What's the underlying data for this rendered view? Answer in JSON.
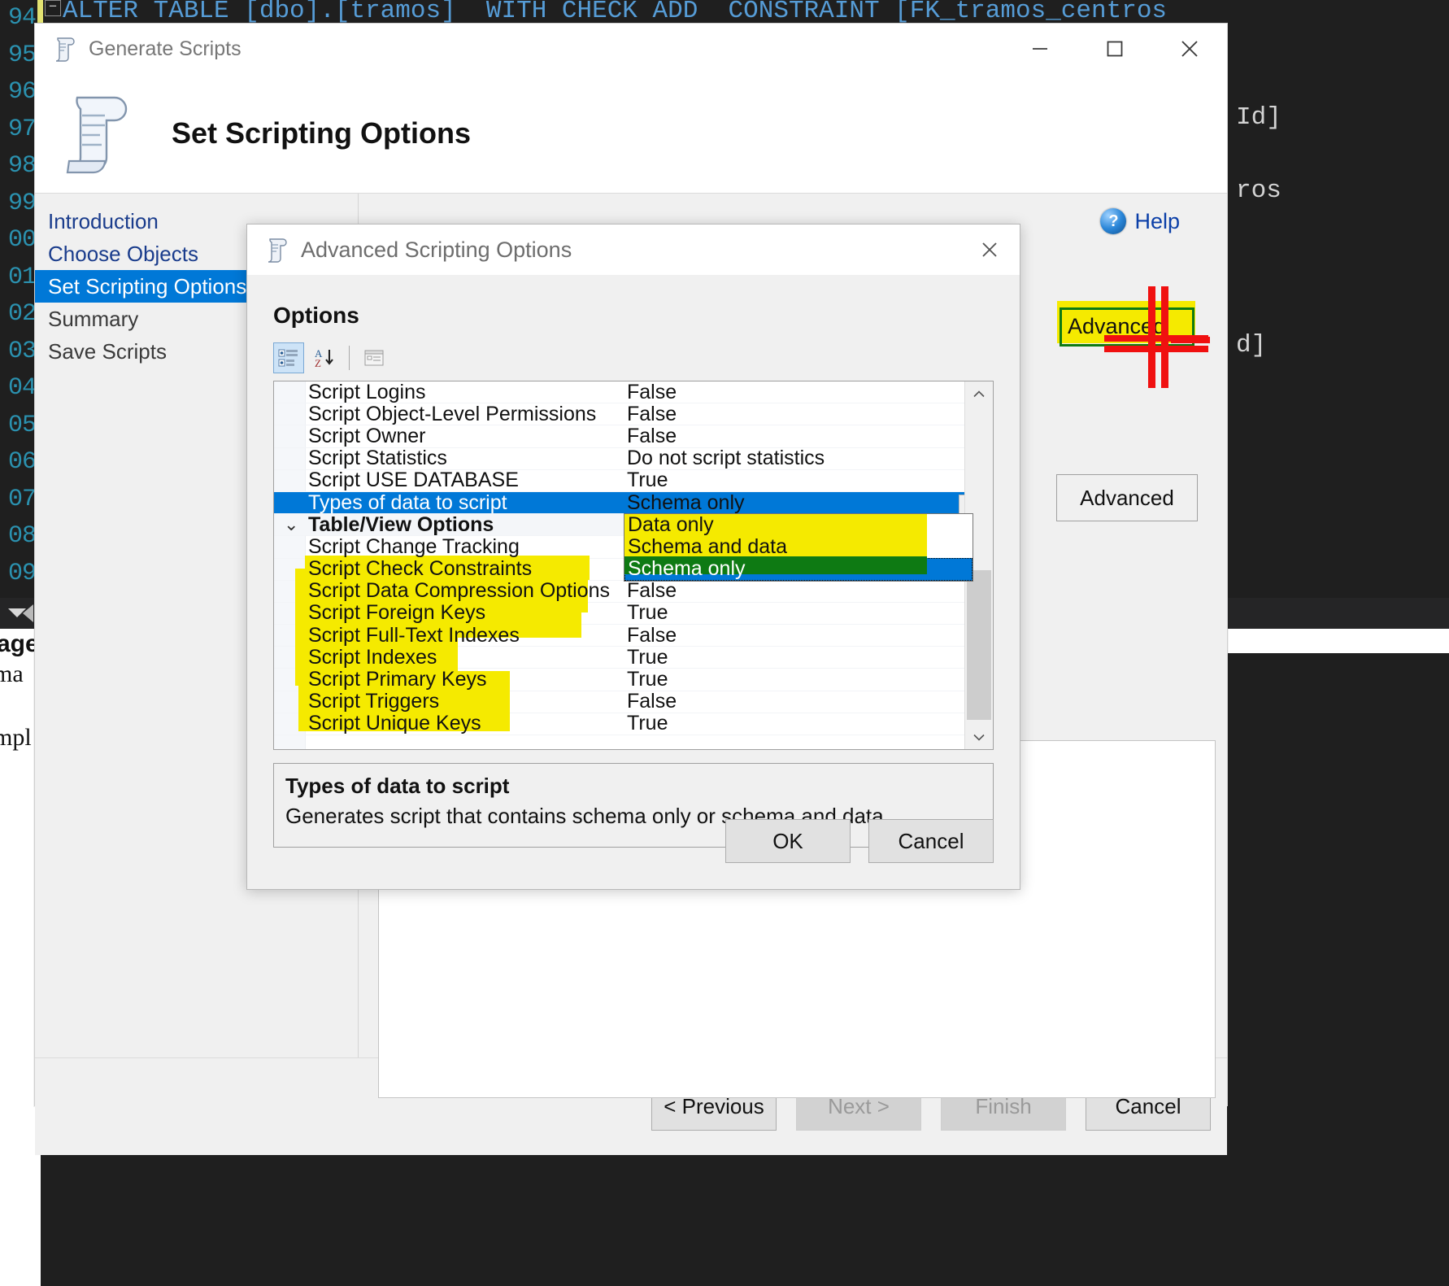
{
  "editor": {
    "line_numbers": [
      "94",
      "95",
      "96",
      "97",
      "98",
      "99",
      "00",
      "01",
      "02",
      "03",
      "04",
      "05",
      "06",
      "07",
      "08",
      "09"
    ],
    "code_line_1": "ALTER TABLE [dbo].[tramos]  WITH CHECK ADD  CONSTRAINT [FK_tramos_centros",
    "code_fragment_right_1": "Id]",
    "code_fragment_right_2": "ros",
    "code_fragment_right_3": "d]",
    "doc_fragment_1": "ages",
    "doc_fragment_2": "ma",
    "doc_fragment_3": "mpl"
  },
  "generate_scripts": {
    "window_title": "Generate Scripts",
    "page_title": "Set Scripting Options",
    "minimize_label": "Minimize",
    "maximize_label": "Maximize",
    "close_label": "Close",
    "sidebar": {
      "items": [
        {
          "label": "Introduction",
          "state": "link"
        },
        {
          "label": "Choose Objects",
          "state": "link"
        },
        {
          "label": "Set Scripting Options",
          "state": "active"
        },
        {
          "label": "Summary",
          "state": "plain"
        },
        {
          "label": "Save Scripts",
          "state": "plain"
        }
      ]
    },
    "help_label": "Help",
    "help_icon": "help-circle-icon",
    "advanced_button": "Advanced",
    "footer_buttons": [
      {
        "label": "< Previous",
        "enabled": true
      },
      {
        "label": "Next >",
        "enabled": false
      },
      {
        "label": "Finish",
        "enabled": false
      },
      {
        "label": "Cancel",
        "enabled": true
      }
    ]
  },
  "advanced_dialog": {
    "title": "Advanced Scripting Options",
    "close_label": "Close",
    "section_title": "Options",
    "toolbar": [
      {
        "name": "categorized-view-icon",
        "pressed": true
      },
      {
        "name": "alphabetical-sort-icon",
        "pressed": false
      },
      {
        "name": "property-pages-icon",
        "pressed": false
      }
    ],
    "rows": [
      {
        "name": "Script Logins",
        "value": "False",
        "type": "row"
      },
      {
        "name": "Script Object-Level Permissions",
        "value": "False",
        "type": "row"
      },
      {
        "name": "Script Owner",
        "value": "False",
        "type": "row"
      },
      {
        "name": "Script Statistics",
        "value": "Do not script statistics",
        "type": "row"
      },
      {
        "name": "Script USE DATABASE",
        "value": "True",
        "type": "row"
      },
      {
        "name": "Types of data to script",
        "value": "Schema only",
        "type": "row",
        "selected": true,
        "has_dropdown": true
      },
      {
        "name": "Table/View Options",
        "value": "",
        "type": "category",
        "expanded": true
      },
      {
        "name": "Script Change Tracking",
        "value": "False",
        "type": "row"
      },
      {
        "name": "Script Check Constraints",
        "value": "True",
        "type": "row",
        "highlighted": true
      },
      {
        "name": "Script Data Compression Options",
        "value": "False",
        "type": "row",
        "highlighted": true
      },
      {
        "name": "Script Foreign Keys",
        "value": "True",
        "type": "row",
        "highlighted": true
      },
      {
        "name": "Script Full-Text Indexes",
        "value": "False",
        "type": "row",
        "highlighted": true
      },
      {
        "name": "Script Indexes",
        "value": "True",
        "type": "row",
        "highlighted": true
      },
      {
        "name": "Script Primary Keys",
        "value": "True",
        "type": "row",
        "highlighted": true
      },
      {
        "name": "Script Triggers",
        "value": "False",
        "type": "row",
        "highlighted": true
      },
      {
        "name": "Script Unique Keys",
        "value": "True",
        "type": "row"
      }
    ],
    "dropdown": {
      "open": true,
      "options": [
        {
          "label": "Data only",
          "selected": false,
          "highlighted": true
        },
        {
          "label": "Schema and data",
          "selected": false,
          "highlighted": true
        },
        {
          "label": "Schema only",
          "selected": true,
          "highlighted": true
        }
      ]
    },
    "description": {
      "title": "Types of data to script",
      "text": "Generates script that contains schema only or schema and data."
    },
    "buttons": [
      {
        "label": "OK"
      },
      {
        "label": "Cancel"
      }
    ]
  },
  "annotations": {
    "advanced_callout_label": "Advanced",
    "highlight_color": "#f5ea00",
    "pen_red": "#f01010",
    "pen_green": "#0e7a13",
    "accent_blue": "#0078d7"
  }
}
